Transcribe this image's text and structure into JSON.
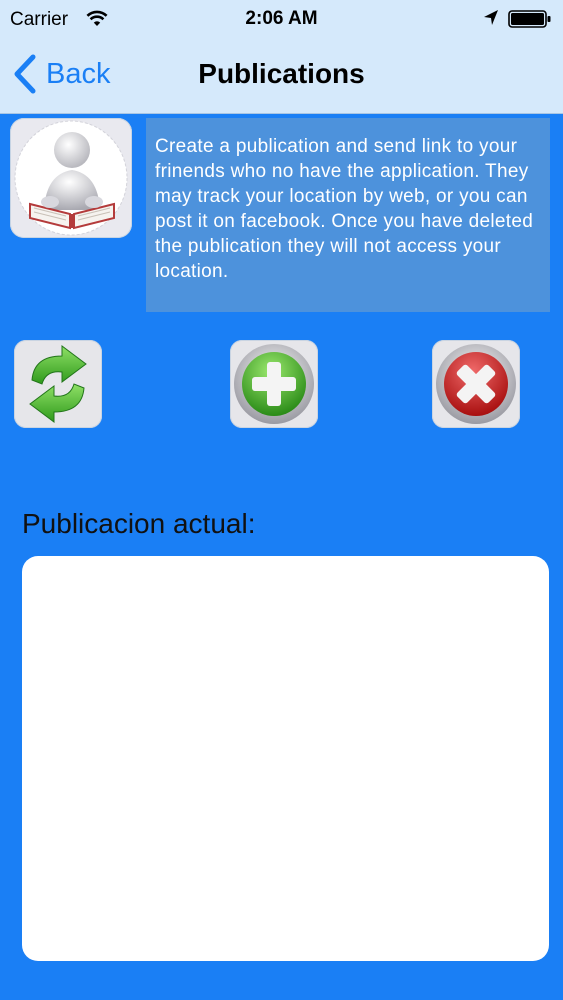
{
  "status_bar": {
    "carrier": "Carrier",
    "time": "2:06 AM",
    "icons": [
      "wifi-icon",
      "location-arrow-icon",
      "battery-icon"
    ]
  },
  "nav": {
    "back_label": "Back",
    "title": "Publications"
  },
  "info": {
    "text": "Create a publication and send link to your frinends who no have the application. They may track your location by web, or you can post it on facebook. Once you have deleted the publication they will not access your location."
  },
  "actions": {
    "icons": [
      "refresh-icon",
      "add-icon",
      "delete-icon"
    ]
  },
  "current": {
    "label": "Publicacion actual:",
    "value": ""
  },
  "colors": {
    "background": "#1a7ff5",
    "topbar": "#d5e9fb",
    "info_box": "#4d92dc",
    "accent": "#1a7ff5"
  }
}
